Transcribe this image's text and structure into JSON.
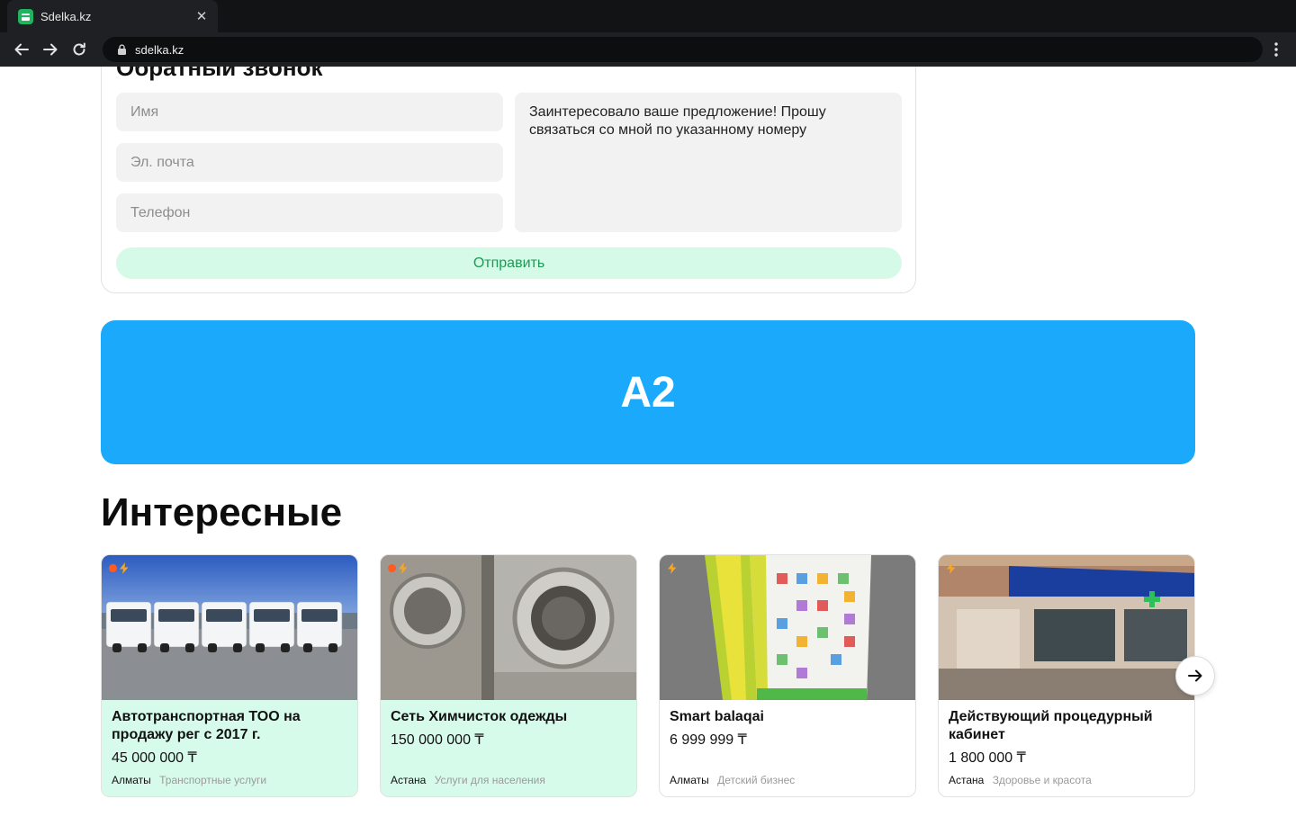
{
  "browser": {
    "tab_title": "Sdelka.kz",
    "url": "sdelka.kz"
  },
  "callback": {
    "title": "Обратный звонок",
    "name_placeholder": "Имя",
    "email_placeholder": "Эл. почта",
    "phone_placeholder": "Телефон",
    "message": "Заинтересовало ваше предложение! Прошу связаться со мной по указанному номеру",
    "submit_label": "Отправить"
  },
  "banner": {
    "label": "A2",
    "color": "#1ba9fb"
  },
  "section": {
    "title": "Интересные"
  },
  "listings": [
    {
      "title": "Автотранспортная ТОО на продажу рег с 2017 г.",
      "price": "45 000 000 ₸",
      "city": "Алматы",
      "category": "Транспортные услуги",
      "highlighted": true,
      "image": "white-trucks-photo"
    },
    {
      "title": "Сеть Химчисток одежды",
      "price": "150 000 000 ₸",
      "city": "Астана",
      "category": "Услуги для населения",
      "highlighted": true,
      "image": "washing-machines-photo"
    },
    {
      "title": "Smart balaqai",
      "price": "6 999 999 ₸",
      "city": "Алматы",
      "category": "Детский бизнес",
      "highlighted": false,
      "image": "educational-board-photo"
    },
    {
      "title": "Действующий процедурный кабинет",
      "price": "1 800 000 ₸",
      "city": "Астана",
      "category": "Здоровье и красота",
      "highlighted": false,
      "image": "clinic-storefront-photo"
    }
  ],
  "colors": {
    "accent_green": "#1c9b55",
    "promo_card_bg": "#d6fbea",
    "badge_orange": "#ff5a1f",
    "badge_bolt": "#f6a623"
  }
}
